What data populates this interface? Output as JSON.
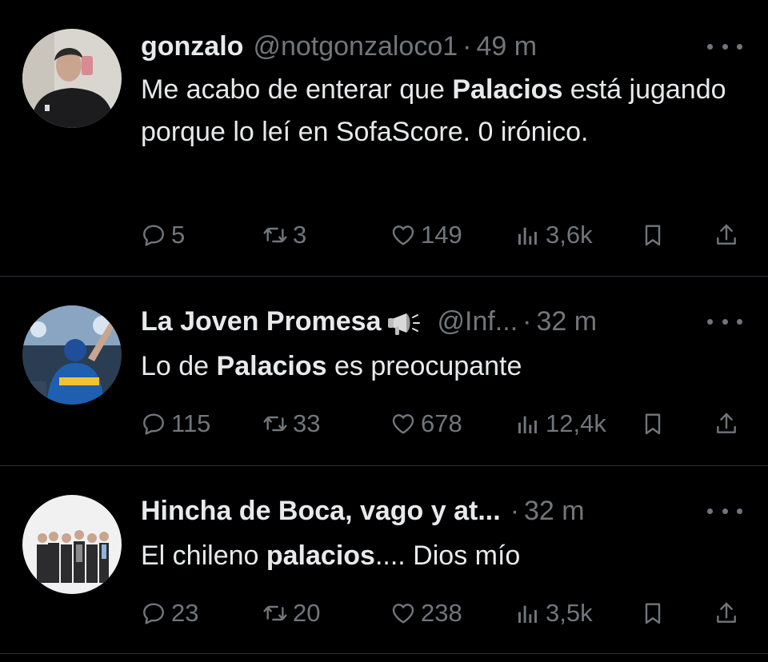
{
  "tweets": [
    {
      "name": "gonzalo",
      "handle": "@notgonzaloco1",
      "dot": "·",
      "time": "49 m",
      "text": [
        {
          "t": "Me acabo de enterar que ",
          "bold": false
        },
        {
          "t": "Palacios",
          "bold": true
        },
        {
          "t": " está jugando porque lo leí en SofaScore. 0 irónico.",
          "bold": false
        }
      ],
      "stats": {
        "replies": "5",
        "retweets": "3",
        "likes": "149",
        "views": "3,6k"
      }
    },
    {
      "name": "La Joven Promesa",
      "badge_icon": "megaphone-icon",
      "handle": "@Inf...",
      "dot": "·",
      "time": "32 m",
      "text": [
        {
          "t": "Lo de ",
          "bold": false
        },
        {
          "t": "Palacios",
          "bold": true
        },
        {
          "t": " es preocupante",
          "bold": false
        }
      ],
      "stats": {
        "replies": "115",
        "retweets": "33",
        "likes": "678",
        "views": "12,4k"
      }
    },
    {
      "name": "Hincha de Boca, vago y at...",
      "dot": "·",
      "time": "32 m",
      "text": [
        {
          "t": "El chileno ",
          "bold": false
        },
        {
          "t": "palacios",
          "bold": true
        },
        {
          "t": ".... Dios mío",
          "bold": false
        }
      ],
      "stats": {
        "replies": "23",
        "retweets": "20",
        "likes": "238",
        "views": "3,5k"
      }
    }
  ],
  "avatars": [
    "avatar-hoodie-selfie",
    "avatar-stadium-fan",
    "avatar-group-photo"
  ],
  "icons": [
    "reply-icon",
    "retweet-icon",
    "like-icon",
    "views-icon",
    "bookmark-icon",
    "share-icon",
    "more-icon"
  ],
  "colors": {
    "background": "#000000",
    "text": "#e7e9ea",
    "secondary": "#71767b",
    "divider": "#2f3336"
  }
}
